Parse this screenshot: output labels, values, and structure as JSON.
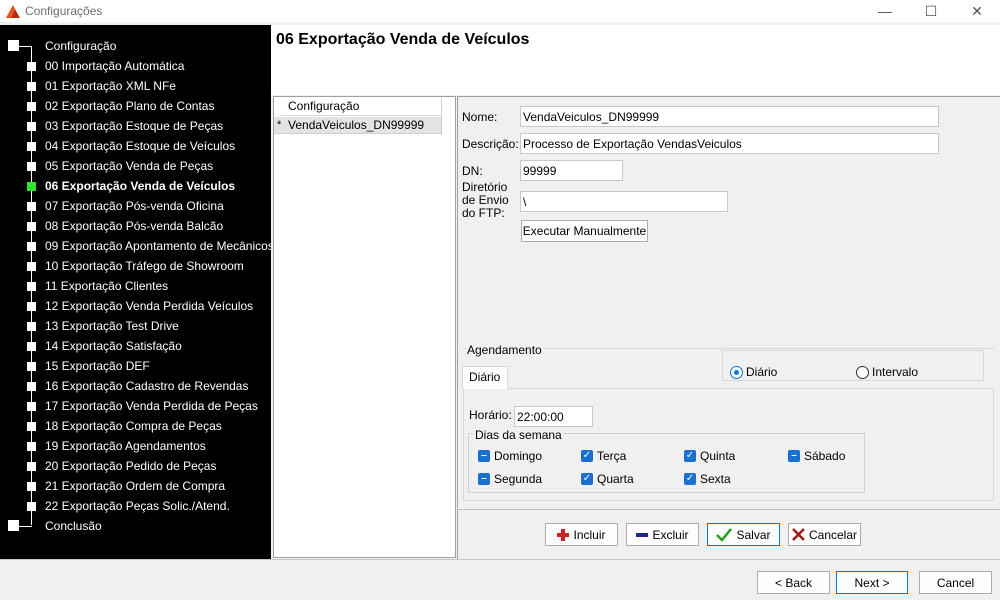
{
  "window": {
    "title": "Configurações",
    "minimize": "—",
    "maximize": "☐",
    "close": "✕"
  },
  "nav": {
    "root": "Configuração",
    "items": [
      "00 Importação Automática",
      "01 Exportação XML NFe",
      "02 Exportação Plano de Contas",
      "03 Exportação Estoque de Peças",
      "04 Exportação Estoque de Veículos",
      "05 Exportação Venda de Peças",
      "06 Exportação Venda de Veículos",
      "07 Exportação Pós-venda Oficina",
      "08 Exportação Pós-venda Balcão",
      "09 Exportação Apontamento de Mecânicos",
      "10 Exportação Tráfego de Showroom",
      "11 Exportação Clientes",
      "12 Exportação Venda Perdida Veículos",
      "13 Exportação Test Drive",
      "14 Exportação Satisfação",
      "15 Exportação DEF",
      "16 Exportação Cadastro de Revendas",
      "17 Exportação Venda Perdida de Peças",
      "18 Exportação Compra de Peças",
      "19 Exportação Agendamentos",
      "20 Exportação Pedido de Peças",
      "21 Exportação Ordem de Compra",
      "22 Exportação Peças Solic./Atend."
    ],
    "active_index": 6,
    "end": "Conclusão",
    "active_color": "#2ee52e"
  },
  "page": {
    "title": "06 Exportação Venda de Veículos"
  },
  "list": {
    "header": "Configuração",
    "rows": [
      {
        "marker": "*",
        "label": "VendaVeiculos_DN99999"
      }
    ]
  },
  "form": {
    "nome_label": "Nome:",
    "nome_value": "VendaVeiculos_DN99999",
    "descricao_label": "Descrição:",
    "descricao_value": "Processo de Exportação VendasVeiculos",
    "dn_label": "DN:",
    "dn_value": "99999",
    "diretorio_label_1": "Diretório",
    "diretorio_label_2": "de Envio",
    "diretorio_label_3": "do FTP:",
    "diretorio_value": "\\",
    "executar_label": "Executar Manualmente"
  },
  "agendamento": {
    "caption": "Agendamento",
    "radio_diario": "Diário",
    "radio_intervalo": "Intervalo",
    "selected": "Diário",
    "tab_label": "Diário",
    "horario_label": "Horário:",
    "horario_value": "22:00:00",
    "dias_caption": "Dias da semana",
    "dias": [
      {
        "label": "Domingo",
        "checked": false
      },
      {
        "label": "Terça",
        "checked": true
      },
      {
        "label": "Quinta",
        "checked": true
      },
      {
        "label": "Sábado",
        "checked": false
      },
      {
        "label": "Segunda",
        "checked": false
      },
      {
        "label": "Quarta",
        "checked": true
      },
      {
        "label": "Sexta",
        "checked": true
      }
    ]
  },
  "actions": {
    "incluir": "Incluir",
    "excluir": "Excluir",
    "salvar": "Salvar",
    "cancelar": "Cancelar"
  },
  "footer": {
    "back": "< Back",
    "next": "Next >",
    "cancel": "Cancel"
  }
}
